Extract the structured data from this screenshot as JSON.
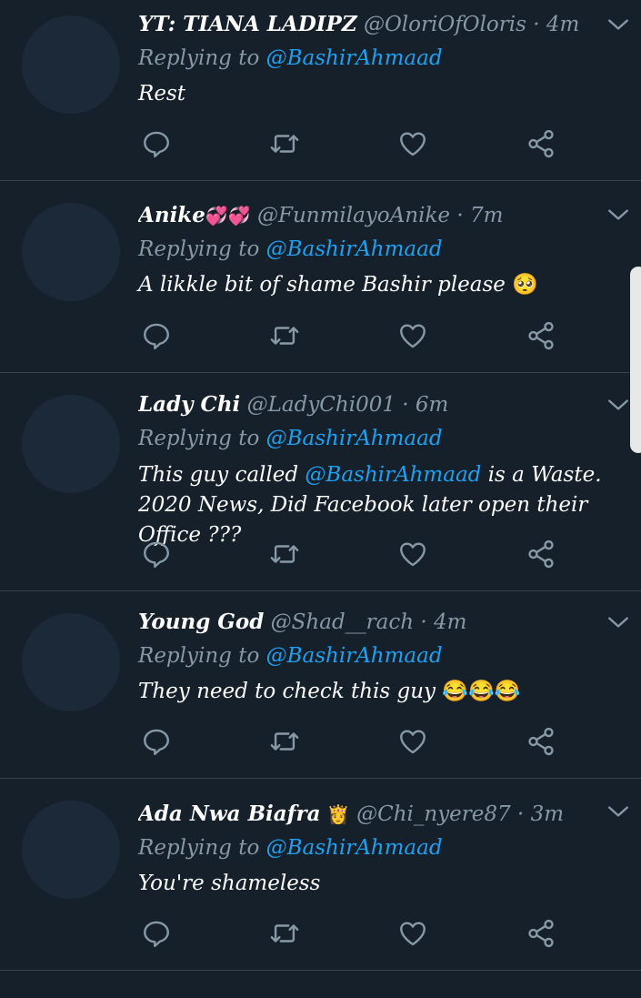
{
  "colors": {
    "background": "#15202b",
    "divider": "#38444d",
    "muted_text": "#8899a6",
    "mention": "#1da1f2",
    "avatar_placeholder": "#1c2938"
  },
  "replying_prefix": "Replying to",
  "dot": "·",
  "tweets": [
    {
      "name": "YT: TIANA LADIPZ",
      "name_emoji": "",
      "handle": "@OloriOfOloris",
      "time": "4m",
      "reply_to": "@BashirAhmaad",
      "text": "Rest"
    },
    {
      "name": "Anike",
      "name_emoji": "💞💞",
      "handle": "@FunmilayoAnike",
      "time": "7m",
      "reply_to": "@BashirAhmaad",
      "text": "A likkle bit of shame Bashir please",
      "text_emoji": "🥺"
    },
    {
      "name": "Lady Chi",
      "name_emoji": "",
      "handle": "@LadyChi001",
      "time": "6m",
      "reply_to": "@BashirAhmaad",
      "text_pre": "This guy called",
      "text_mention": "@BashirAhmaad",
      "text_post": " is a Waste. 2020 News, Did Facebook later open their Office ???"
    },
    {
      "name": "Young God",
      "name_emoji": "",
      "handle": "@Shad__rach",
      "time": "4m",
      "reply_to": "@BashirAhmaad",
      "text": "They need to check this guy",
      "text_emoji": "😂😂😂"
    },
    {
      "name": "Ada Nwa Biafra",
      "name_emoji": "👸",
      "handle": "@Chi_nyere87",
      "time": "3m",
      "reply_to": "@BashirAhmaad",
      "text": "You're shameless"
    }
  ],
  "icons": {
    "reply": "reply-icon",
    "retweet": "retweet-icon",
    "like": "like-icon",
    "share": "share-icon",
    "more": "chevron-down-icon"
  }
}
